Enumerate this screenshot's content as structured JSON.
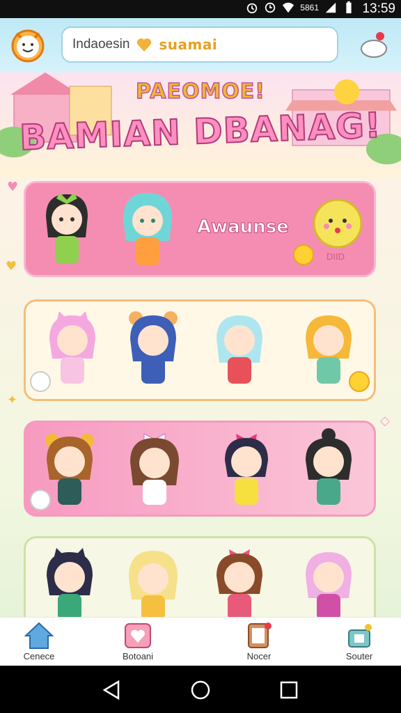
{
  "status_bar": {
    "time": "13:59",
    "network_label": "5861"
  },
  "header": {
    "search_placeholder": "Indaoesin",
    "search_brand": "suamai"
  },
  "banner": {
    "welcome": "PAEOMOE!",
    "title": "BAMIAN DBANAG!"
  },
  "cards": [
    {
      "label": "Awaunse",
      "sub": "DIID"
    }
  ],
  "bottom_nav": [
    {
      "label": "Cenece"
    },
    {
      "label": "Botoani"
    },
    {
      "label": "Nocer"
    },
    {
      "label": "Souter"
    }
  ],
  "colors": {
    "accent_pink": "#f58db2",
    "header_blue": "#bfe9f6",
    "brand_gold": "#e6a020"
  },
  "icons": [
    "home-icon",
    "heart-box-icon",
    "list-tablet-icon",
    "shop-icon"
  ]
}
